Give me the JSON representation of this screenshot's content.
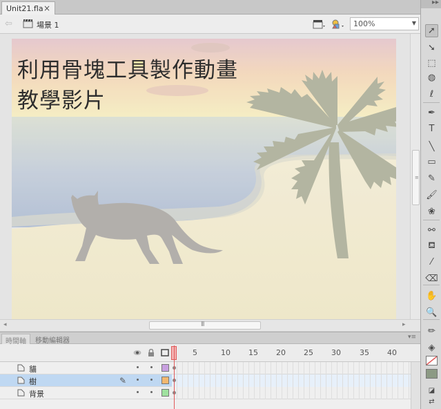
{
  "document": {
    "tab_title": "Unit21.fla",
    "close_glyph": "×"
  },
  "editbar": {
    "scene_label": "場景 1",
    "zoom_value": "100%"
  },
  "stage": {
    "title_line1": "利用骨塊工具製作動畫",
    "title_line2": "教學影片"
  },
  "panel": {
    "tabs": [
      {
        "label": "時間軸"
      },
      {
        "label": "移動編輯器"
      }
    ]
  },
  "timeline": {
    "frame_numbers": [
      "5",
      "10",
      "15",
      "20",
      "25",
      "30",
      "35",
      "40"
    ],
    "layers": [
      {
        "name": "貓",
        "color": "#c8a0e0",
        "selected": false
      },
      {
        "name": "樹",
        "color": "#f2b870",
        "selected": true
      },
      {
        "name": "背景",
        "color": "#9fe29f",
        "selected": false
      }
    ]
  },
  "tools": [
    {
      "name": "selection-tool-icon",
      "glyph": "➚"
    },
    {
      "name": "subselection-tool-icon",
      "glyph": "➘"
    },
    {
      "name": "free-transform-tool-icon",
      "glyph": "⬚"
    },
    {
      "name": "3d-rotation-tool-icon",
      "glyph": "◍"
    },
    {
      "name": "lasso-tool-icon",
      "glyph": "ℓ"
    },
    {
      "name": "pen-tool-icon",
      "glyph": "✒"
    },
    {
      "name": "text-tool-icon",
      "glyph": "T"
    },
    {
      "name": "line-tool-icon",
      "glyph": "╲"
    },
    {
      "name": "rectangle-tool-icon",
      "glyph": "▭"
    },
    {
      "name": "pencil-tool-icon",
      "glyph": "✎"
    },
    {
      "name": "brush-tool-icon",
      "glyph": "🖌"
    },
    {
      "name": "deco-tool-icon",
      "glyph": "❀"
    },
    {
      "name": "bone-tool-icon",
      "glyph": "⚯"
    },
    {
      "name": "paint-bucket-tool-icon",
      "glyph": "⛾"
    },
    {
      "name": "eyedropper-tool-icon",
      "glyph": "⁄"
    },
    {
      "name": "eraser-tool-icon",
      "glyph": "⌫"
    },
    {
      "name": "hand-tool-icon",
      "glyph": "✋"
    },
    {
      "name": "zoom-tool-icon",
      "glyph": "🔍"
    },
    {
      "name": "stroke-color-icon",
      "glyph": "✏"
    },
    {
      "name": "fill-color-icon",
      "glyph": "◈"
    }
  ],
  "colors": {
    "fill_swatch": "#8c9a84",
    "playhead": "#e05a5a"
  }
}
